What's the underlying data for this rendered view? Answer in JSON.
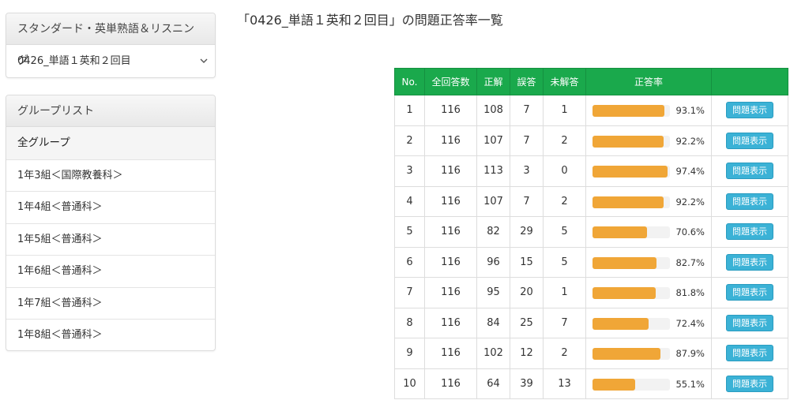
{
  "course_panel": {
    "header": "スタンダード・英単熟語＆リスニング",
    "selected": "0426_単語１英和２回目"
  },
  "group_panel": {
    "header": "グループリスト",
    "items": [
      {
        "label": "全グループ",
        "active": true
      },
      {
        "label": "1年3組＜国際教養科＞"
      },
      {
        "label": "1年4組＜普通科＞"
      },
      {
        "label": "1年5組＜普通科＞"
      },
      {
        "label": "1年6組＜普通科＞"
      },
      {
        "label": "1年7組＜普通科＞"
      },
      {
        "label": "1年8組＜普通科＞"
      }
    ]
  },
  "page_title": "「0426_単語１英和２回目」の問題正答率一覧",
  "table": {
    "headers": [
      "No.",
      "全回答数",
      "正解",
      "誤答",
      "未解答",
      "正答率",
      ""
    ],
    "button_label": "問題表示",
    "rows": [
      {
        "no": "1",
        "total": "116",
        "correct": "108",
        "wrong": "7",
        "unanswered": "1",
        "rate_text": "93.1%",
        "rate": 93.1
      },
      {
        "no": "2",
        "total": "116",
        "correct": "107",
        "wrong": "7",
        "unanswered": "2",
        "rate_text": "92.2%",
        "rate": 92.2
      },
      {
        "no": "3",
        "total": "116",
        "correct": "113",
        "wrong": "3",
        "unanswered": "0",
        "rate_text": "97.4%",
        "rate": 97.4
      },
      {
        "no": "4",
        "total": "116",
        "correct": "107",
        "wrong": "7",
        "unanswered": "2",
        "rate_text": "92.2%",
        "rate": 92.2
      },
      {
        "no": "5",
        "total": "116",
        "correct": "82",
        "wrong": "29",
        "unanswered": "5",
        "rate_text": "70.6%",
        "rate": 70.6
      },
      {
        "no": "6",
        "total": "116",
        "correct": "96",
        "wrong": "15",
        "unanswered": "5",
        "rate_text": "82.7%",
        "rate": 82.7
      },
      {
        "no": "7",
        "total": "116",
        "correct": "95",
        "wrong": "20",
        "unanswered": "1",
        "rate_text": "81.8%",
        "rate": 81.8
      },
      {
        "no": "8",
        "total": "116",
        "correct": "84",
        "wrong": "25",
        "unanswered": "7",
        "rate_text": "72.4%",
        "rate": 72.4
      },
      {
        "no": "9",
        "total": "116",
        "correct": "102",
        "wrong": "12",
        "unanswered": "2",
        "rate_text": "87.9%",
        "rate": 87.9
      },
      {
        "no": "10",
        "total": "116",
        "correct": "64",
        "wrong": "39",
        "unanswered": "13",
        "rate_text": "55.1%",
        "rate": 55.1
      }
    ]
  },
  "colors": {
    "header_green": "#1aa94c",
    "bar_orange": "#f0a637",
    "button_blue": "#3bb2d6"
  },
  "icons": {
    "select_chevron": "chevron-down-icon"
  }
}
